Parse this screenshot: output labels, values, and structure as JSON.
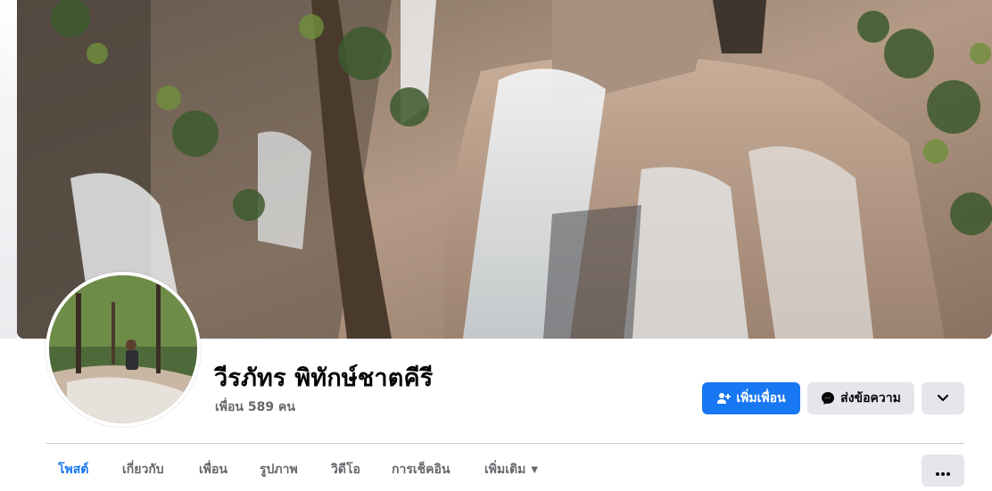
{
  "profile": {
    "name": "วีรภัทร พิทักษ์ชาตคีรี",
    "friends_count": "เพื่อน 589 คน"
  },
  "actions": {
    "add_friend_label": "เพิ่มเพื่อน",
    "message_label": "ส่งข้อความ",
    "more_icon": "chevron-down-icon"
  },
  "tabs": [
    {
      "label": "โพสต์",
      "active": true
    },
    {
      "label": "เกี่ยวกับ",
      "active": false
    },
    {
      "label": "เพื่อน",
      "active": false
    },
    {
      "label": "รูปภาพ",
      "active": false
    },
    {
      "label": "วิดีโอ",
      "active": false
    },
    {
      "label": "การเช็คอิน",
      "active": false
    },
    {
      "label": "เพิ่มเติม",
      "active": false
    }
  ],
  "colors": {
    "accent": "#1877f2",
    "secondary_button": "#e4e6eb",
    "muted_text": "#65676b"
  }
}
